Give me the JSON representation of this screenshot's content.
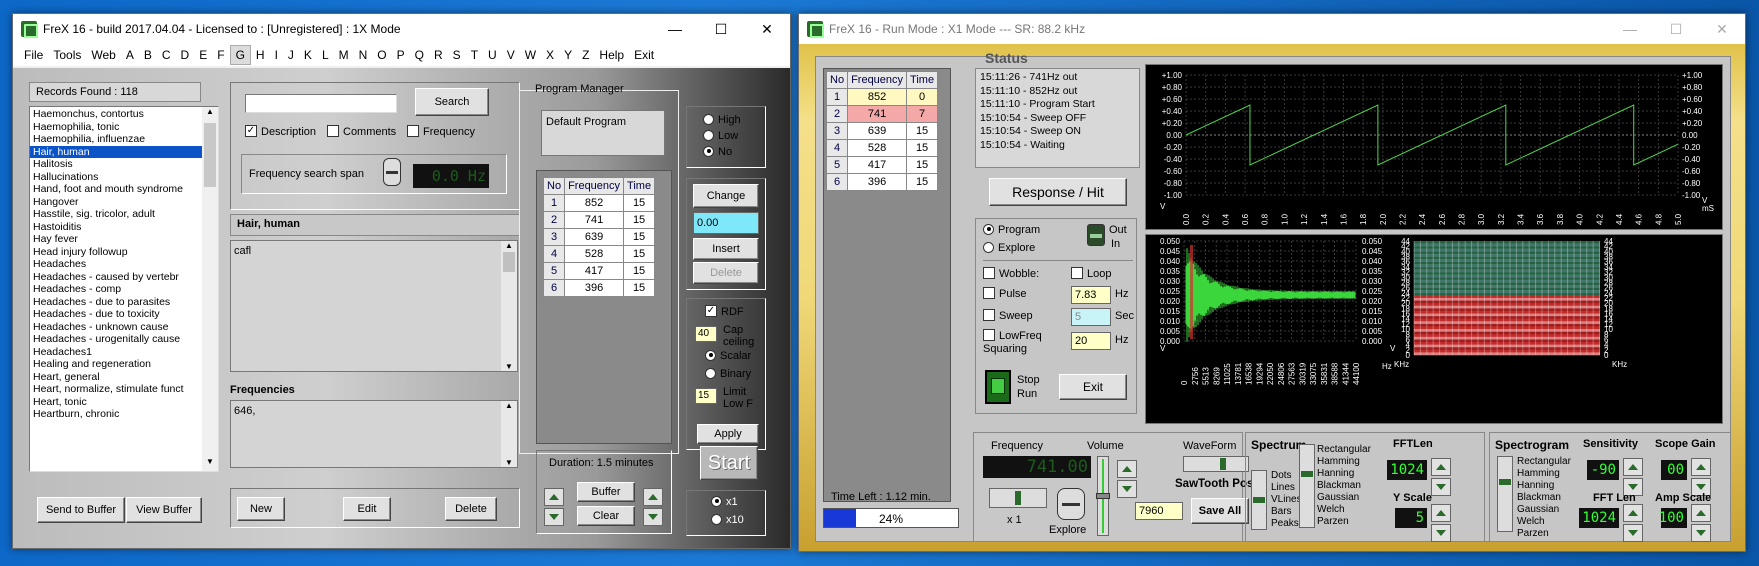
{
  "left_window": {
    "title": "FreX 16 - build 2017.04.04 - Licensed to : [Unregistered]  :  1X Mode",
    "menu": [
      "File",
      "Tools",
      "Web",
      "A",
      "B",
      "C",
      "D",
      "E",
      "F",
      "G",
      "H",
      "I",
      "J",
      "K",
      "L",
      "M",
      "N",
      "O",
      "P",
      "Q",
      "R",
      "S",
      "T",
      "U",
      "V",
      "W",
      "X",
      "Y",
      "Z",
      "Help",
      "Exit"
    ],
    "selected_menu": "G",
    "records_found": "Records Found :  118",
    "records": [
      "Haemonchus, contortus",
      "Haemophilia, tonic",
      "Haemophilia, influenzae",
      "Hair, human",
      "Halitosis",
      "Hallucinations",
      "Hand, foot and mouth syndrome",
      "Hangover",
      "Hasstile, sig. tricolor, adult",
      "Hastoiditis",
      "Hay fever",
      "Head injury followup",
      "Headaches",
      "Headaches - caused by vertebr",
      "Headaches - comp",
      "Headaches - due to parasites",
      "Headaches - due to toxicity",
      "Headaches - unknown cause",
      "Headaches - urogenitally cause",
      "Headaches1",
      "Healing and regeneration",
      "Heart, general",
      "Heart, normalize, stimulate funct",
      "Heart, tonic",
      "Heartburn, chronic"
    ],
    "selected_record": "Hair, human",
    "search_button": "Search",
    "search_value": "",
    "filters": {
      "description": "Description",
      "comments": "Comments",
      "frequency": "Frequency"
    },
    "freq_span_label": "Frequency search span",
    "freq_span_lcd": "0.0 Hz",
    "selected_title": "Hair, human",
    "description_text": "cafl",
    "frequencies_label": "Frequencies",
    "frequencies_text": "646,",
    "send_to_buffer": "Send to Buffer",
    "view_buffer": "View Buffer",
    "new": "New",
    "edit": "Edit",
    "delete": "Delete",
    "program_manager": "Program Manager",
    "default_program": "Default Program",
    "table_headers": [
      "No",
      "Frequency",
      "Time"
    ],
    "table_rows": [
      [
        "1",
        "852",
        "15"
      ],
      [
        "2",
        "741",
        "15"
      ],
      [
        "3",
        "639",
        "15"
      ],
      [
        "4",
        "528",
        "15"
      ],
      [
        "5",
        "417",
        "15"
      ],
      [
        "6",
        "396",
        "15"
      ]
    ],
    "priority": {
      "high": "High",
      "low": "Low",
      "no": "No"
    },
    "change": "Change",
    "change_value": "0.00",
    "insert": "Insert",
    "delete2": "Delete",
    "rdf": "RDF",
    "cap_value": "40",
    "cap_label": "Cap ceiling",
    "scalar": "Scalar",
    "binary": "Binary",
    "limit_value": "15",
    "limit_label": "Limit Low F",
    "apply": "Apply",
    "duration": "Duration: 1.5 minutes",
    "buffer": "Buffer",
    "clear": "Clear",
    "start": "Start",
    "x1": "x1",
    "x10": "x10"
  },
  "right_window": {
    "title": "FreX 16 - Run Mode :  X1 Mode  ---  SR: 88.2 kHz",
    "status_title": "Status",
    "status_lines": [
      "15:11:26 -  741Hz out",
      "15:11:10 -  852Hz out",
      "15:11:10 - Program Start",
      "15:10:54 - Sweep OFF",
      "15:10:54 - Sweep ON",
      "15:10:54 - Waiting"
    ],
    "run_table_headers": [
      "No",
      "Frequency",
      "Time"
    ],
    "run_table_rows": [
      [
        "1",
        "852",
        "0"
      ],
      [
        "2",
        "741",
        "7"
      ],
      [
        "3",
        "639",
        "15"
      ],
      [
        "4",
        "528",
        "15"
      ],
      [
        "5",
        "417",
        "15"
      ],
      [
        "6",
        "396",
        "15"
      ]
    ],
    "highlight_color": "#f4a8a8",
    "first_row_color": "#fff8c0",
    "time_left": "Time Left : 1.12 min.",
    "progress_text": "24%",
    "progress": 0.24,
    "response_hit": "Response / Hit",
    "program": "Program",
    "explore": "Explore",
    "out": "Out",
    "in": "In",
    "wobble": "Wobble:",
    "loop": "Loop",
    "pulse": "Pulse",
    "pulse_value": "7.83",
    "hz": "Hz",
    "sweep": "Sweep",
    "sweep_value": "5",
    "sec": "Sec",
    "lowfreq": "LowFreq Squaring",
    "lowfreq_value": "20",
    "stop": "Stop",
    "run": "Run",
    "exit": "Exit",
    "frequency_label": "Frequency",
    "freq_lcd": "741.00",
    "x1_label": "x 1",
    "volume_label": "Volume",
    "explore_label": "Explore",
    "waveform_label": "WaveForm",
    "waveform_value": "SawTooth Pos",
    "vol_value": "7960",
    "save_all": "Save All",
    "spectrum_title": "Spectrum",
    "spectrum_types": [
      "Dots",
      "Lines",
      "VLines",
      "Bars",
      "Peaks"
    ],
    "windows": [
      "Rectangular",
      "Hamming",
      "Hanning",
      "Blackman",
      "Gaussian",
      "Welch",
      "Parzen"
    ],
    "fftlen_label": "FFTLen",
    "fftlen_value": "1024",
    "yscale_label": "Y Scale",
    "yscale_value": "5",
    "spectrogram_title": "Spectrogram",
    "sensitivity_label": "Sensitivity",
    "sensitivity_value": "-90",
    "scope_gain_label": "Scope Gain",
    "scope_gain_value": "00",
    "fft_len_label": "FFT Len",
    "fft_len_value": "1024",
    "amp_scale_label": "Amp Scale",
    "amp_scale_value": "100",
    "scope_y_labels": [
      "+1.00",
      "+0.80",
      "+0.60",
      "+0.40",
      "+0.20",
      "0.00",
      "-0.20",
      "-0.40",
      "-0.60",
      "-0.80",
      "-1.00"
    ],
    "scope_x_labels": [
      "0.0",
      "0.2",
      "0.4",
      "0.6",
      "0.8",
      "1.0",
      "1.2",
      "1.4",
      "1.6",
      "1.8",
      "2.0",
      "2.2",
      "2.4",
      "2.6",
      "2.8",
      "3.0",
      "3.2",
      "3.4",
      "3.6",
      "3.8",
      "4.0",
      "4.2",
      "4.4",
      "4.6",
      "4.8",
      "5.0"
    ],
    "scope_x_unit": "mS",
    "scope_v": "V",
    "spec_y_labels": [
      "0.050",
      "0.045",
      "0.040",
      "0.035",
      "0.030",
      "0.025",
      "0.020",
      "0.015",
      "0.010",
      "0.005",
      "0.000"
    ],
    "spec_x_labels": [
      "0",
      "2756",
      "5513",
      "8269",
      "11025",
      "13781",
      "16538",
      "19294",
      "22050",
      "24806",
      "27563",
      "30319",
      "33075",
      "35831",
      "38588",
      "41344",
      "44100"
    ],
    "spec_unit": "Hz",
    "sg_labels": [
      "44",
      "42",
      "40",
      "38",
      "36",
      "34",
      "32",
      "30",
      "28",
      "26",
      "24",
      "22",
      "20",
      "18",
      "16",
      "14",
      "12",
      "10",
      "8",
      "6",
      "4",
      "2",
      "0"
    ],
    "sg_unit": "KHz"
  }
}
